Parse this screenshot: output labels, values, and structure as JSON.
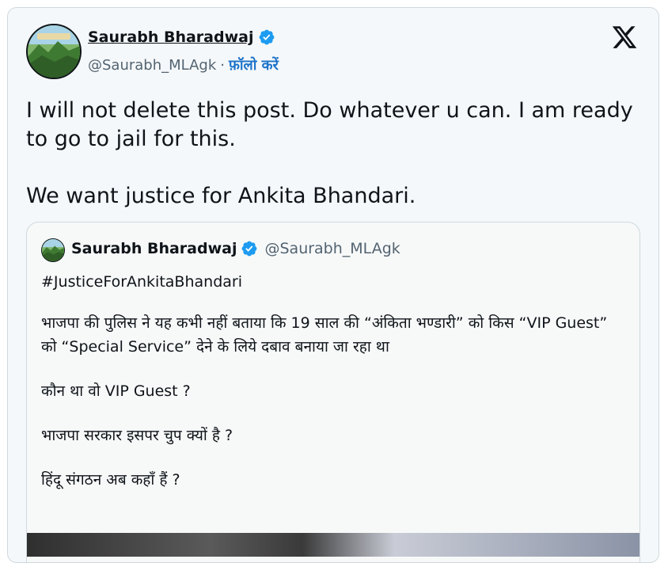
{
  "tweet": {
    "author": {
      "name": "Saurabh Bharadwaj",
      "handle": "@Saurabh_MLAgk",
      "separator": "·",
      "follow_label": "फ़ॉलो करें",
      "verified": true
    },
    "text": {
      "line1": "I will not delete this post. Do whatever u can. I am ready to go to jail for this.",
      "line2": "We want justice for Ankita Bhandari."
    }
  },
  "quoted_tweet": {
    "author": {
      "name": "Saurabh Bharadwaj",
      "handle": "@Saurabh_MLAgk",
      "verified": true
    },
    "hashtag": "#JusticeForAnkitaBhandari",
    "paragraph1": "भाजपा की पुलिस ने यह कभी नहीं बताया कि 19 साल की “अंकिता भण्डारी” को किस “VIP Guest” को “Special Service” देने के लिये दबाव बनाया जा रहा था",
    "paragraph2": "कौन था वो VIP Guest  ?",
    "paragraph3": "भाजपा सरकार इसपर चुप क्यों है ?",
    "paragraph4": "हिंदू संगठन अब कहाँ हैं ?"
  },
  "colors": {
    "follow": "#1d73c9",
    "verified": "#1d9bf0",
    "secondary_text": "#536471",
    "border": "#cfd9de"
  },
  "icons": {
    "verified": "verified-badge-icon",
    "brand": "x-logo-icon"
  }
}
